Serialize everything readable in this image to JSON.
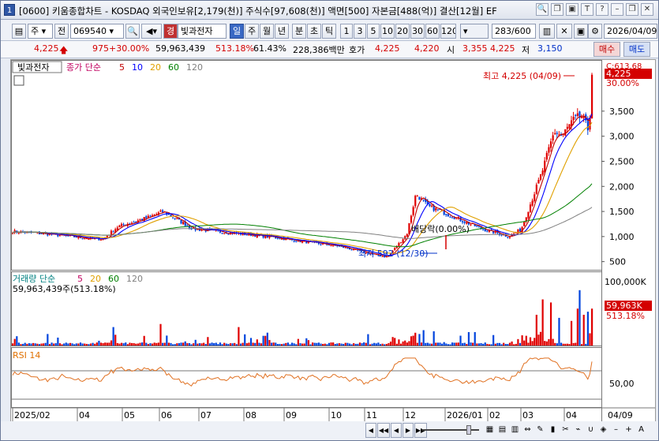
{
  "window": {
    "num": "1",
    "title": "[0600] 키움종합차트 - KOSDAQ 외국인보유[2,179(천)] 주식수[97,608(천)] 액면[500] 자본금[488(억)] 결산[12월] EF",
    "controls": [
      "search-icon",
      "copy-icon",
      "window-icon",
      "font-icon",
      "help-icon",
      "minimize-icon",
      "restore-icon",
      "close-icon"
    ],
    "controls_glyph": [
      "🔍",
      "❐",
      "▣",
      "T",
      "?",
      "–",
      "❐",
      "✕"
    ]
  },
  "toolbar": {
    "period": "주",
    "prev": "전",
    "code": "069540",
    "stock_label": "경",
    "stock_name": "빛과전자",
    "day": "일",
    "week": "주",
    "month": "월",
    "year": "년",
    "minute": "분",
    "second": "초",
    "tick": "틱",
    "intervals": [
      "1",
      "3",
      "5",
      "10",
      "20",
      "30",
      "60",
      "120"
    ],
    "count": "283",
    "total": "/600",
    "date": "2026/04/09"
  },
  "quote": {
    "price": "4,225",
    "change": "975",
    "pct": "+30.00%",
    "volume": "59,963,439",
    "vol_pct": "513.18%",
    "turnover": "61.43%",
    "amount": "228,386백만",
    "ask_label": "호가",
    "ask": "4,225",
    "bid": "4,220",
    "open_label": "시",
    "open": "3,355",
    "high": "4,225",
    "low_label": "저",
    "low": "3,150",
    "buy": "매수",
    "sell": "매도"
  },
  "price_panel": {
    "stock": "빛과전자",
    "legend_label": "종가 단순",
    "ma": [
      "5",
      "10",
      "20",
      "60",
      "120"
    ],
    "ma_colors": [
      "#c00000",
      "#0000ff",
      "#e0a000",
      "#008000",
      "#808080"
    ],
    "max_label": "최고 4,225 (04/09)",
    "min_label": "최저 592 (12/30)",
    "div_label": "배당락(0.00%)",
    "y_ticks": [
      "500",
      "1,000",
      "1,500",
      "2,000",
      "2,500",
      "3,000",
      "3,500"
    ],
    "cur_tag": "4,225",
    "cur_pct": "30.00%",
    "cur_top": "C:613.68"
  },
  "volume_panel": {
    "legend_label": "거래량 단순",
    "ma": [
      "5",
      "20",
      "60",
      "120"
    ],
    "value_label": "59,963,439주(513.18%)",
    "y_top": "100,000K",
    "tag": "59,963K",
    "tag_pct": "513.18%"
  },
  "rsi_panel": {
    "legend_label": "RSI 14",
    "y_tick": "50,00"
  },
  "x_axis": {
    "labels": [
      "2025/02",
      "04",
      "05",
      "06",
      "07",
      "08",
      "09",
      "10",
      "11",
      "12",
      "2026/01",
      "02",
      "03",
      "04"
    ],
    "end_label": "04/09"
  },
  "chart_data": {
    "type": "candlestick",
    "ylim": [
      400,
      4300
    ],
    "y_ticks": [
      500,
      1000,
      1500,
      2000,
      2500,
      3000,
      3500
    ],
    "max": {
      "value": 4225,
      "date": "04/09"
    },
    "min": {
      "value": 592,
      "date": "12/30"
    },
    "close_last": 4225,
    "volume_last": 59963439,
    "volume_ylim": [
      0,
      100000000
    ]
  }
}
